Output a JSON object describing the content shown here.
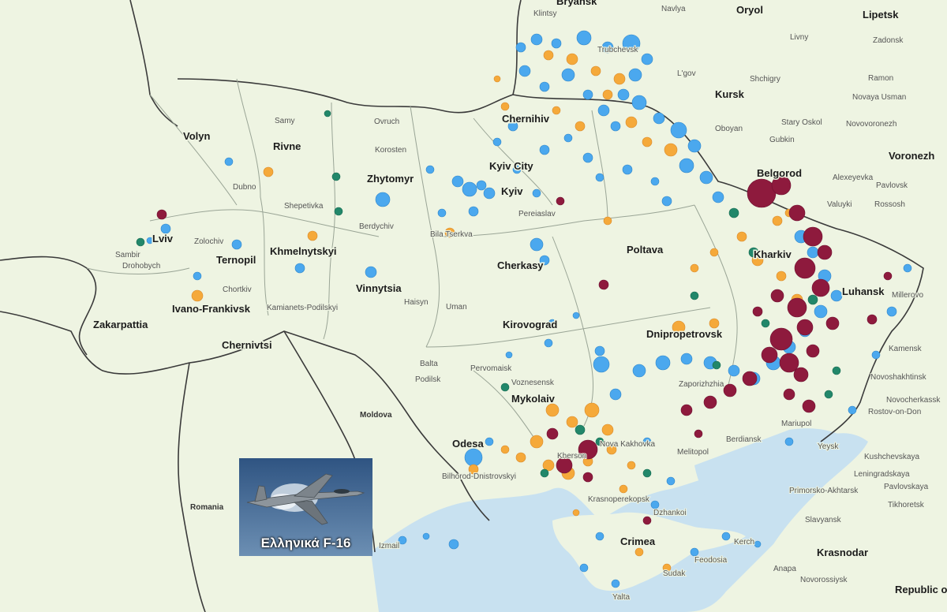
{
  "map": {
    "regions_ukraine": [
      "Volyn",
      "Rivne",
      "Zhytomyr",
      "Lviv",
      "Ternopil",
      "Khmelnytskyi",
      "Vinnytsia",
      "Ivano-Frankivsk",
      "Zakarpattia",
      "Chernivtsi",
      "Chernihiv",
      "Kyiv City",
      "Kyiv",
      "Cherkasy",
      "Kirovograd",
      "Mykolaiv",
      "Odesa",
      "Dnipropetrovsk",
      "Poltava",
      "Kharkiv",
      "Luhansk",
      "Crimea"
    ],
    "cities_other": [
      "Bryansk",
      "Oryol",
      "Lipetsk",
      "Kursk",
      "Belgorod",
      "Voronezh",
      "Krasnodar",
      "Republic of Adygea",
      "Romania",
      "Moldova",
      "Rostov-on-Don"
    ],
    "small_places": [
      "Klintsy",
      "Trubchevsk",
      "Navlya",
      "Zadonsk",
      "Livny",
      "Ramon",
      "Novaya Usman",
      "Novovoronezh",
      "Shchigry",
      "L'gov",
      "Stary Oskol",
      "Oboyan",
      "Gubkin",
      "Alexeyevka",
      "Pavlovsk",
      "Rossosh",
      "Valuyki",
      "Samy",
      "Ovruch",
      "Korosten",
      "Dubno",
      "Shepetivka",
      "Berdychiv",
      "Bila Tserkva",
      "Pereiaslav",
      "Zolochiv",
      "Drohobych",
      "Sambir",
      "Chortkiv",
      "Kamianets-Podilskyi",
      "Uman",
      "Haisyn",
      "Pervomaisk",
      "Voznesensk",
      "Balta",
      "Podilsk",
      "Bilhorod-Dnistrovskyi",
      "Izmail",
      "Kherson",
      "Nova Kakhovka",
      "Melitopol",
      "Berdiansk",
      "Mariupol",
      "Zaporizhzhia",
      "Krasnoperekopsk",
      "Dzhankoi",
      "Feodosia",
      "Sudak",
      "Kerch",
      "Yalta",
      "Yeysk",
      "Kushchevskaya",
      "Leningradskaya",
      "Pavlovskaya",
      "Tikhoretsk",
      "Primorsko-Akhtarsk",
      "Slavyansk",
      "Anapa",
      "Novorossiysk",
      "Millerovo",
      "Kamensk",
      "Novoshakhtinsk",
      "Novocherkassk"
    ],
    "colors": {
      "land": "#eef4e2",
      "sea": "#c8e1f0",
      "border": "#3a3a3a",
      "oblast_border": "#9aa596",
      "blue_event": "#4ba8ee",
      "orange_event": "#f5a93a",
      "maroon_event": "#8e1a3d",
      "green_event": "#22876a"
    }
  },
  "photo": {
    "caption": "Ελληνικά F-16",
    "icon": "f16-jet-icon"
  }
}
